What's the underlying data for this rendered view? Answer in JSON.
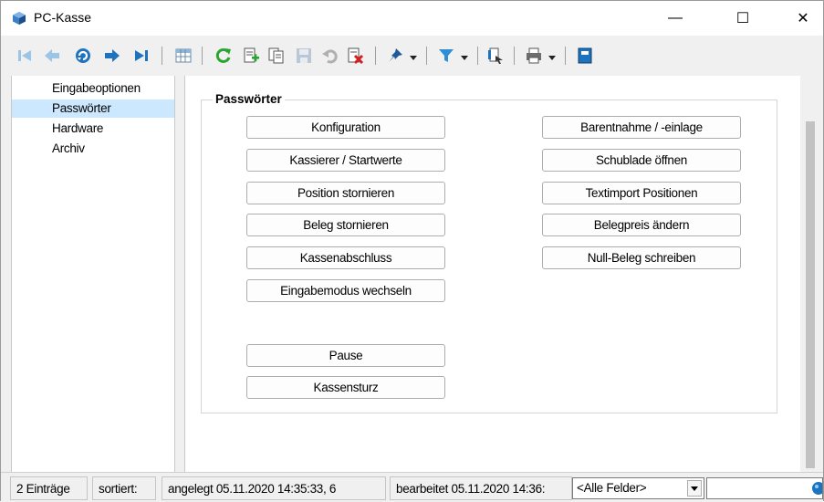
{
  "window": {
    "title": "PC-Kasse",
    "minimize_glyph": "—",
    "maximize_glyph": "☐",
    "close_glyph": "✕"
  },
  "toolbar": {
    "icons": [
      "first-record-icon",
      "previous-record-icon",
      "search-record-icon",
      "next-record-icon",
      "last-record-icon",
      "table-view-icon",
      "refresh-icon",
      "new-record-icon",
      "copy-record-icon",
      "save-icon",
      "undo-icon",
      "delete-icon",
      "pin-icon",
      "filter-icon",
      "export-icon",
      "print-icon",
      "close-panel-icon"
    ]
  },
  "nav": {
    "items": [
      {
        "label": "Eingabeoptionen",
        "selected": false
      },
      {
        "label": "Passwörter",
        "selected": true
      },
      {
        "label": "Hardware",
        "selected": false
      },
      {
        "label": "Archiv",
        "selected": false
      }
    ]
  },
  "group": {
    "title": "Passwörter",
    "left_buttons": [
      "Konfiguration",
      "Kassierer / Startwerte",
      "Position stornieren",
      "Beleg stornieren",
      "Kassenabschluss",
      "Eingabemodus wechseln",
      "Pause",
      "Kassensturz"
    ],
    "right_buttons": [
      "Barentnahme / -einlage",
      "Schublade öffnen",
      "Textimport Positionen",
      "Belegpreis ändern",
      "Null-Beleg schreiben"
    ]
  },
  "status": {
    "count": "2 Einträge",
    "sorted": "sortiert:",
    "created": "angelegt 05.11.2020 14:35:33,  6",
    "edited": "bearbeitet 05.11.2020 14:36:",
    "field_filter": "<Alle Felder>"
  },
  "colors": {
    "selection": "#cce8ff",
    "accent_blue": "#1e73be",
    "accent_green": "#2aa530",
    "accent_red": "#d42020"
  }
}
